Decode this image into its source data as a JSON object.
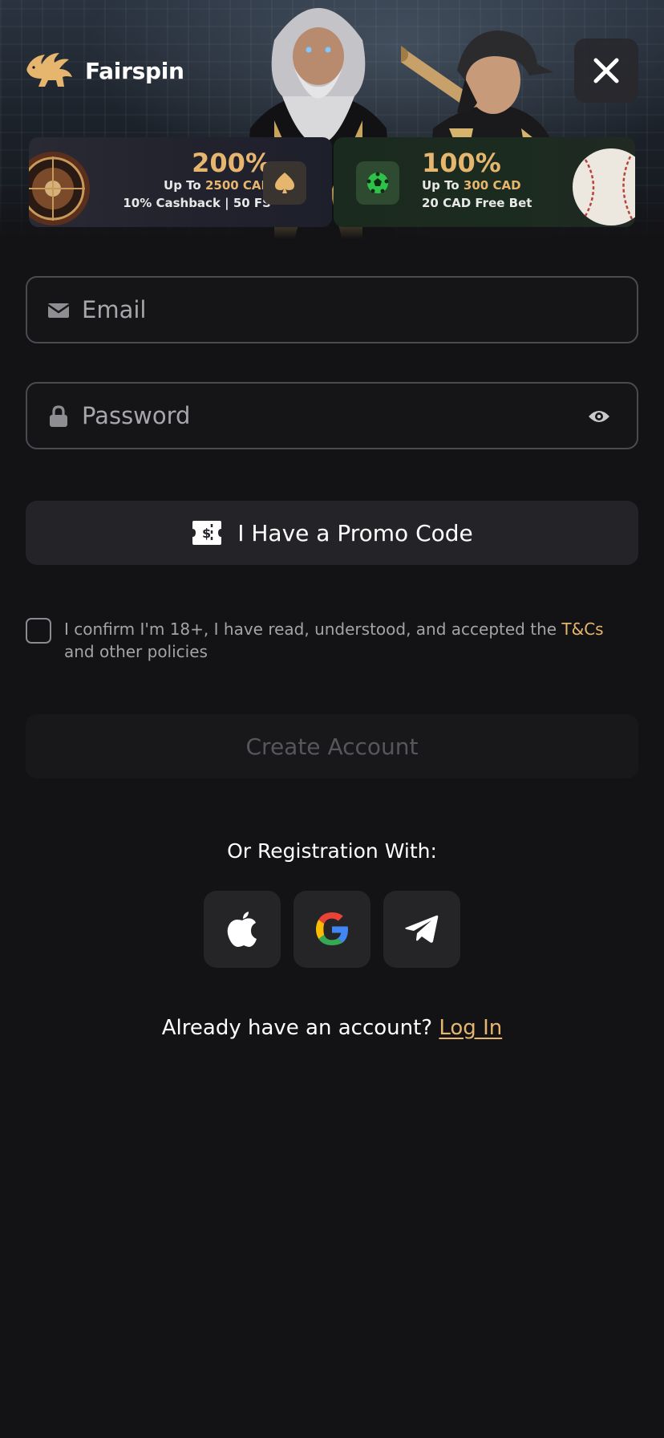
{
  "brand": {
    "name": "Fairspin",
    "accent": "#e6b66e",
    "background": "#131316"
  },
  "header": {
    "close_icon": "close-icon"
  },
  "promos": [
    {
      "headline": "200%",
      "line1_prefix": "Up To ",
      "line1_amount": "2500 CAD",
      "line2": "10% Cashback | 50 FS",
      "icon": "spade-icon"
    },
    {
      "headline": "100%",
      "line1_prefix": "Up To ",
      "line1_amount": "300 CAD",
      "line2": "20 CAD Free Bet",
      "icon": "soccer-ball-icon"
    }
  ],
  "form": {
    "email_placeholder": "Email",
    "password_placeholder": "Password",
    "promo_button": "I Have a Promo Code",
    "consent_text": "I confirm I'm 18+, I have read, understood, and accepted the ",
    "consent_link": "T&Cs",
    "consent_tail": " and other policies",
    "create_button": "Create Account"
  },
  "social": {
    "heading": "Or Registration With:",
    "providers": [
      "apple-icon",
      "google-icon",
      "telegram-icon"
    ]
  },
  "footer": {
    "question": "Already have an account? ",
    "login_link": "Log In"
  }
}
